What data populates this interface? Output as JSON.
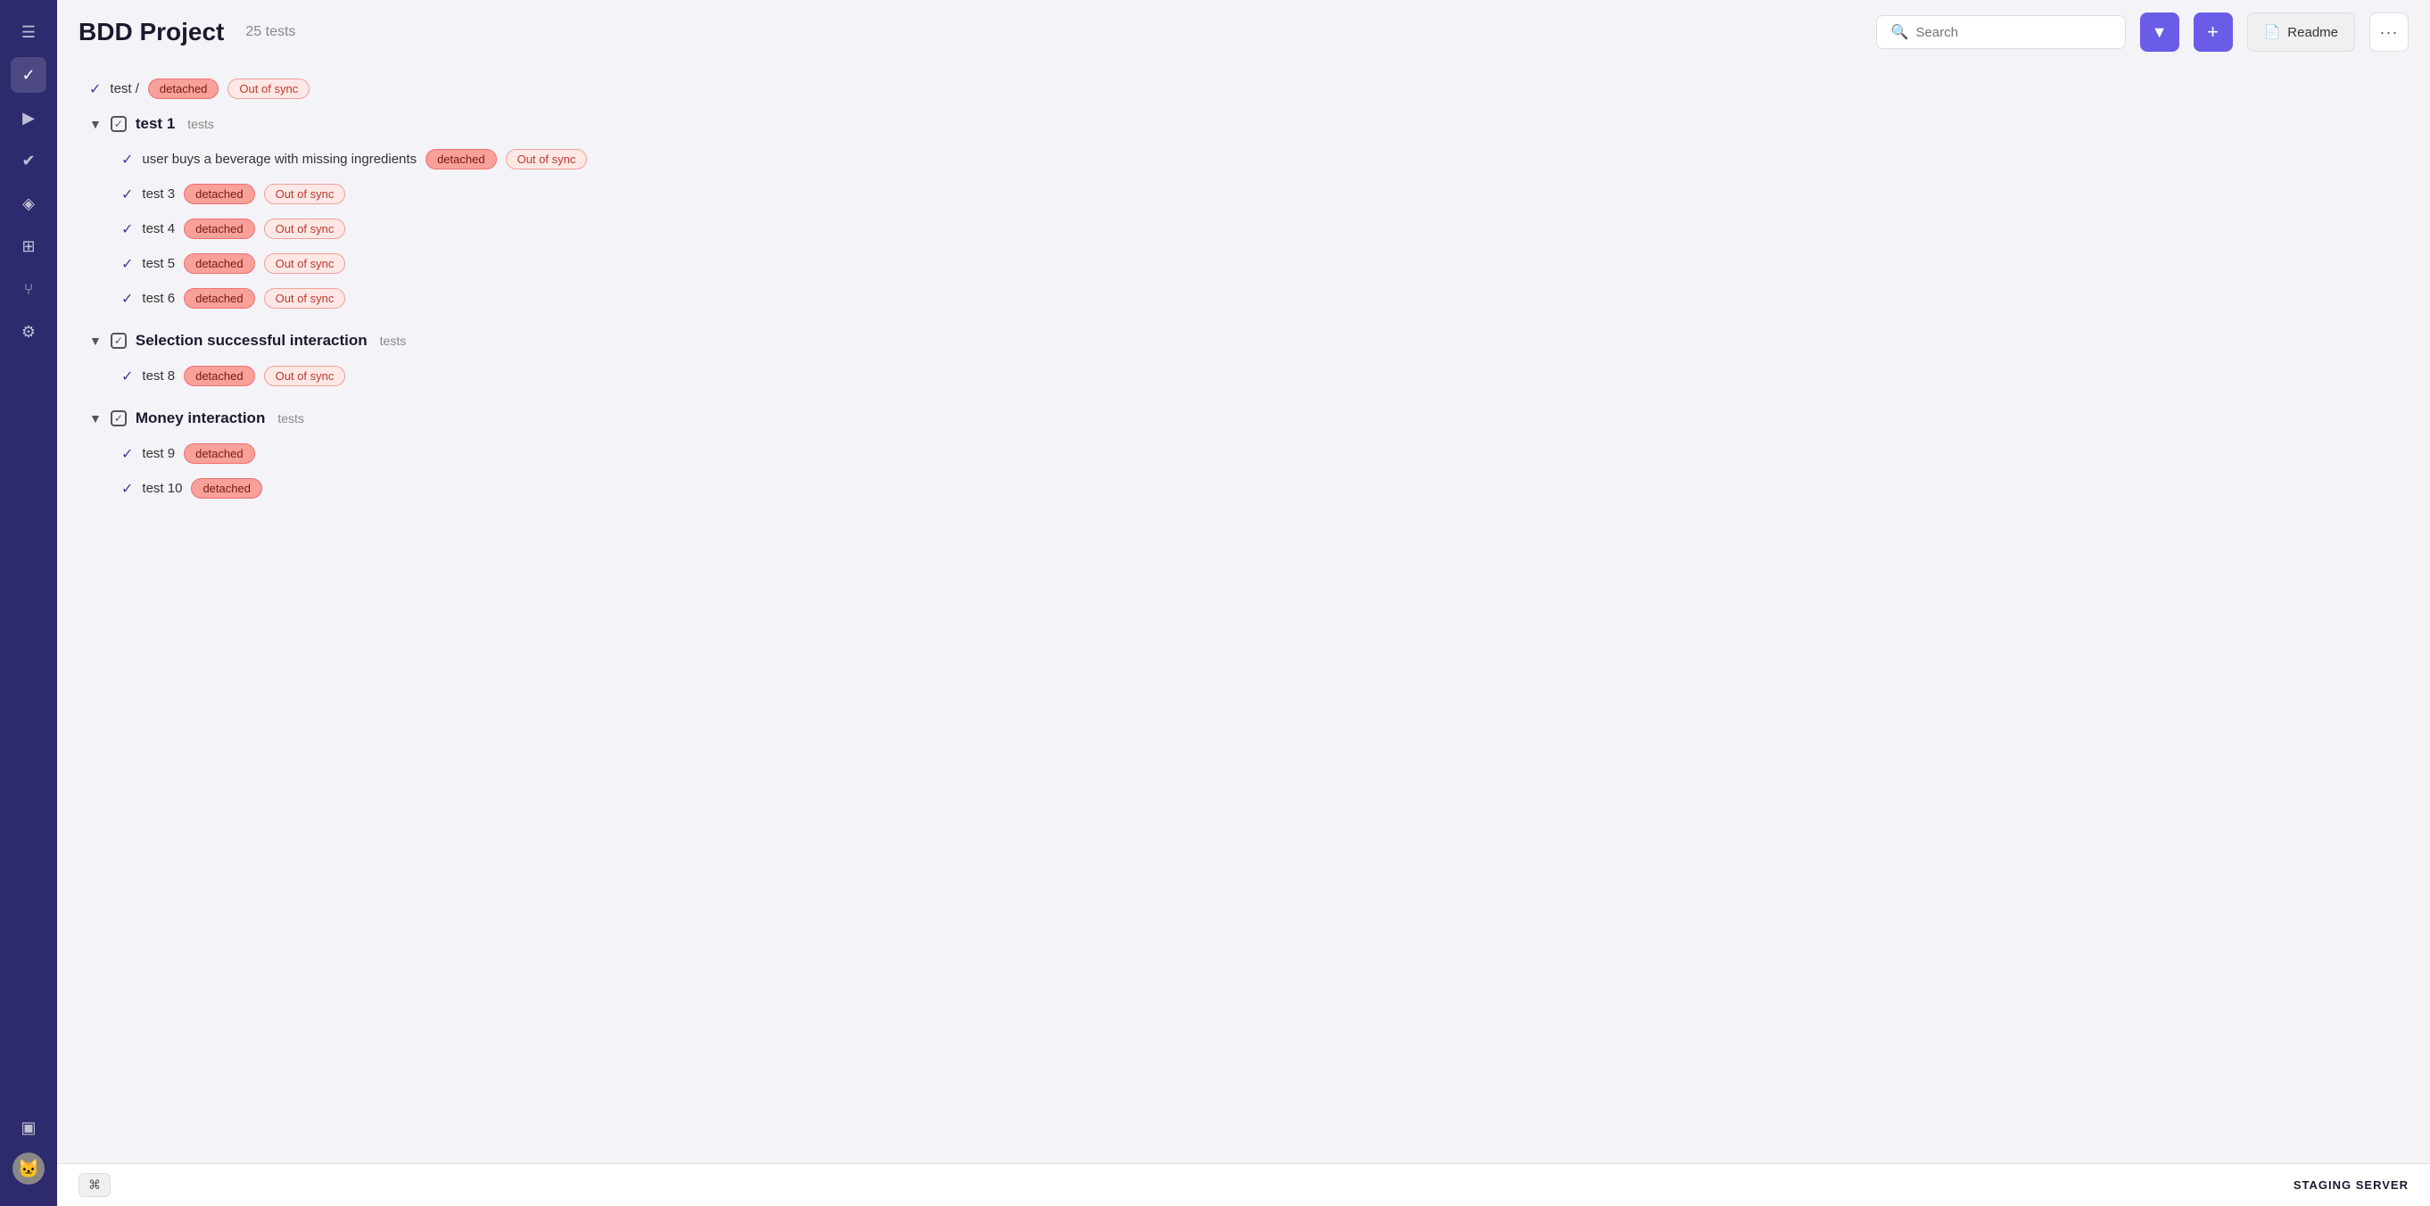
{
  "app": {
    "title": "BDD Project",
    "test_count": "25 tests",
    "server_label": "STAGING SERVER"
  },
  "header": {
    "search_placeholder": "Search",
    "add_label": "+",
    "readme_label": "Readme",
    "more_label": "···"
  },
  "sidebar": {
    "items": [
      {
        "id": "menu",
        "icon": "☰",
        "label": "menu-icon"
      },
      {
        "id": "check",
        "icon": "✓",
        "label": "check-icon"
      },
      {
        "id": "play",
        "icon": "▶",
        "label": "play-icon"
      },
      {
        "id": "list-check",
        "icon": "✔",
        "label": "list-check-icon"
      },
      {
        "id": "layers",
        "icon": "◈",
        "label": "layers-icon"
      },
      {
        "id": "import",
        "icon": "⊞",
        "label": "import-icon"
      },
      {
        "id": "branch",
        "icon": "⑂",
        "label": "branch-icon"
      },
      {
        "id": "settings",
        "icon": "⚙",
        "label": "settings-icon"
      },
      {
        "id": "folder",
        "icon": "▣",
        "label": "folder-icon"
      }
    ]
  },
  "tests": {
    "top_item": {
      "name": "test /",
      "badges": [
        "detached",
        "Out of sync"
      ]
    },
    "sections": [
      {
        "id": "test1",
        "title": "test 1",
        "subtitle": "tests",
        "children": [
          {
            "name": "user buys a beverage with missing ingredients",
            "badges": [
              "detached",
              "Out of sync"
            ]
          },
          {
            "name": "test 3",
            "badges": [
              "detached",
              "Out of sync"
            ]
          },
          {
            "name": "test 4",
            "badges": [
              "detached",
              "Out of sync"
            ]
          },
          {
            "name": "test 5",
            "badges": [
              "detached",
              "Out of sync"
            ]
          },
          {
            "name": "test 6",
            "badges": [
              "detached",
              "Out of sync"
            ]
          }
        ]
      },
      {
        "id": "selection",
        "title": "Selection successful interaction",
        "subtitle": "tests",
        "children": [
          {
            "name": "test 8",
            "badges": [
              "detached",
              "Out of sync"
            ]
          }
        ]
      },
      {
        "id": "money",
        "title": "Money interaction",
        "subtitle": "tests",
        "children": [
          {
            "name": "test 9",
            "badges": [
              "detached"
            ]
          },
          {
            "name": "test 10",
            "badges": [
              "detached"
            ]
          }
        ]
      }
    ]
  },
  "footer": {
    "cmd_label": "⌘",
    "server_label": "STAGING SERVER"
  },
  "badges": {
    "detached": "detached",
    "out_of_sync": "Out of sync"
  }
}
